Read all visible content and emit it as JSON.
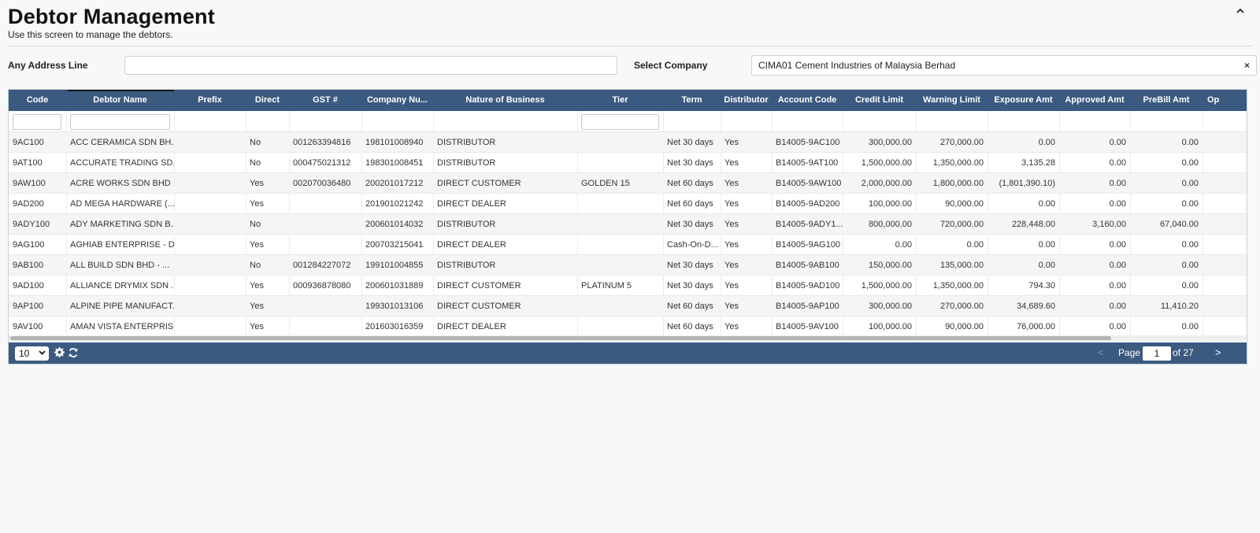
{
  "header": {
    "title": "Debtor Management",
    "subtitle": "Use this screen to manage the debtors.",
    "collapse_icon": "caret-up-icon"
  },
  "filters": {
    "address_label": "Any Address Line",
    "address_value": "",
    "company_label": "Select Company",
    "company_value": "CIMA01 Cement Industries of Malaysia Berhad",
    "clear_symbol": "×"
  },
  "grid": {
    "columns": [
      "Code",
      "Debtor Name",
      "Prefix",
      "Direct",
      "GST #",
      "Company Nu...",
      "Nature of Business",
      "Tier",
      "Term",
      "Distributor",
      "Account Code",
      "Credit Limit",
      "Warning Limit",
      "Exposure Amt",
      "Approved Amt",
      "PreBill Amt",
      "Op"
    ],
    "rows": [
      [
        "9AC100",
        "ACC CERAMICA SDN BH...",
        "",
        "No",
        "001263394816",
        "198101008940",
        "DISTRIBUTOR",
        "",
        "Net 30 days",
        "Yes",
        "B14005-9AC100",
        "300,000.00",
        "270,000.00",
        "0.00",
        "0.00",
        "0.00"
      ],
      [
        "9AT100",
        "ACCURATE TRADING SD...",
        "",
        "No",
        "000475021312",
        "198301008451",
        "DISTRIBUTOR",
        "",
        "Net 30 days",
        "Yes",
        "B14005-9AT100",
        "1,500,000.00",
        "1,350,000.00",
        "3,135.28",
        "0.00",
        "0.00"
      ],
      [
        "9AW100",
        "ACRE WORKS SDN BHD ...",
        "",
        "Yes",
        "002070036480",
        "200201017212",
        "DIRECT CUSTOMER",
        "GOLDEN 15",
        "Net 60 days",
        "Yes",
        "B14005-9AW100",
        "2,000,000.00",
        "1,800,000.00",
        "(1,801,390.10)",
        "0.00",
        "0.00"
      ],
      [
        "9AD200",
        "AD MEGA HARDWARE (...",
        "",
        "Yes",
        "",
        "201901021242",
        "DIRECT DEALER",
        "",
        "Net 60 days",
        "Yes",
        "B14005-9AD200",
        "100,000.00",
        "90,000.00",
        "0.00",
        "0.00",
        "0.00"
      ],
      [
        "9ADY100",
        "ADY MARKETING SDN B...",
        "",
        "No",
        "",
        "200601014032",
        "DISTRIBUTOR",
        "",
        "Net 30 days",
        "Yes",
        "B14005-9ADY1...",
        "800,000.00",
        "720,000.00",
        "228,448.00",
        "3,160.00",
        "67,040.00"
      ],
      [
        "9AG100",
        "AGHIAB ENTERPRISE - D...",
        "",
        "Yes",
        "",
        "200703215041",
        "DIRECT DEALER",
        "",
        "Cash-On-D...",
        "Yes",
        "B14005-9AG100",
        "0.00",
        "0.00",
        "0.00",
        "0.00",
        "0.00"
      ],
      [
        "9AB100",
        "ALL BUILD SDN BHD - ...",
        "",
        "No",
        "001284227072",
        "199101004855",
        "DISTRIBUTOR",
        "",
        "Net 30 days",
        "Yes",
        "B14005-9AB100",
        "150,000.00",
        "135,000.00",
        "0.00",
        "0.00",
        "0.00"
      ],
      [
        "9AD100",
        "ALLIANCE DRYMIX SDN ...",
        "",
        "Yes",
        "000936878080",
        "200601031889",
        "DIRECT CUSTOMER",
        "PLATINUM 5",
        "Net 30 days",
        "Yes",
        "B14005-9AD100",
        "1,500,000.00",
        "1,350,000.00",
        "794.30",
        "0.00",
        "0.00"
      ],
      [
        "9AP100",
        "ALPINE PIPE MANUFACT...",
        "",
        "Yes",
        "",
        "199301013106",
        "DIRECT CUSTOMER",
        "",
        "Net 60 days",
        "Yes",
        "B14005-9AP100",
        "300,000.00",
        "270,000.00",
        "34,689.60",
        "0.00",
        "11,410.20"
      ],
      [
        "9AV100",
        "AMAN VISTA ENTERPRIS...",
        "",
        "Yes",
        "",
        "201603016359",
        "DIRECT DEALER",
        "",
        "Net 60 days",
        "Yes",
        "B14005-9AV100",
        "100,000.00",
        "90,000.00",
        "76,000.00",
        "0.00",
        "0.00"
      ]
    ]
  },
  "pager": {
    "page_size": "10",
    "page_label": "Page",
    "current_page": "1",
    "of_label": "of 27",
    "prev": "<",
    "next": ">"
  }
}
